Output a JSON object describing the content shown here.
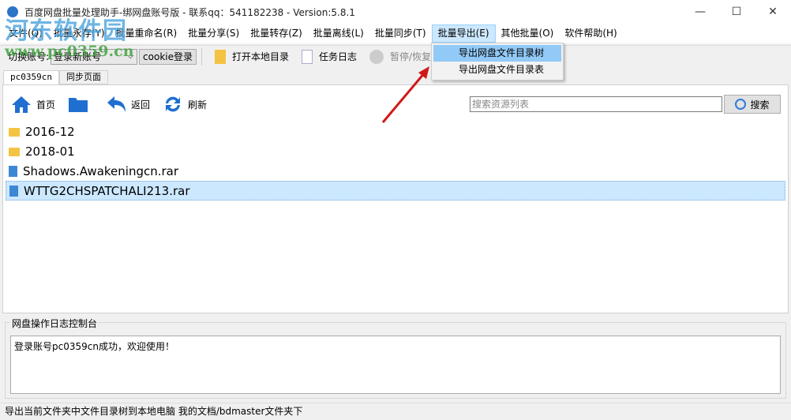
{
  "window": {
    "title": "百度网盘批量处理助手-绑网盘账号版 - 联系qq：541182238 - Version:5.8.1",
    "minimize": "—",
    "maximize": "☐",
    "close": "✕"
  },
  "menu": [
    "文件(Q)",
    "批量永存(Y)",
    "批量重命名(R)",
    "批量分享(S)",
    "批量转存(Z)",
    "批量离线(L)",
    "批量同步(T)",
    "批量导出(E)",
    "其他批量(O)",
    "软件帮助(H)"
  ],
  "toolbar": {
    "switch_label": "切换账号:",
    "account_select": "登录新账号",
    "cookie_button": "cookie登录",
    "open_local": "打开本地目录",
    "task_log": "任务日志",
    "pause": "暂停/恢复"
  },
  "dropdown": [
    "导出网盘文件目录树",
    "导出网盘文件目录表"
  ],
  "tabs": [
    "pc0359cn",
    "同步页面"
  ],
  "nav": {
    "home": "首页",
    "back": "返回",
    "refresh": "刷新"
  },
  "search": {
    "placeholder": "搜索资源列表",
    "button": "搜索"
  },
  "files": [
    {
      "name": "2016-12",
      "type": "folder"
    },
    {
      "name": "2018-01",
      "type": "folder"
    },
    {
      "name": "Shadows.Awakeningcn.rar",
      "type": "file"
    },
    {
      "name": "WTTG2CHSPATCHALI213.rar",
      "type": "file",
      "selected": true
    }
  ],
  "log": {
    "title": "网盘操作日志控制台",
    "text": "登录账号pc0359cn成功，欢迎使用！"
  },
  "status": "导出当前文件夹中文件目录树到本地电脑 我的文档/bdmaster文件夹下",
  "watermark": {
    "line1": "河东软件园",
    "line2": "www.pc0359.cn"
  }
}
